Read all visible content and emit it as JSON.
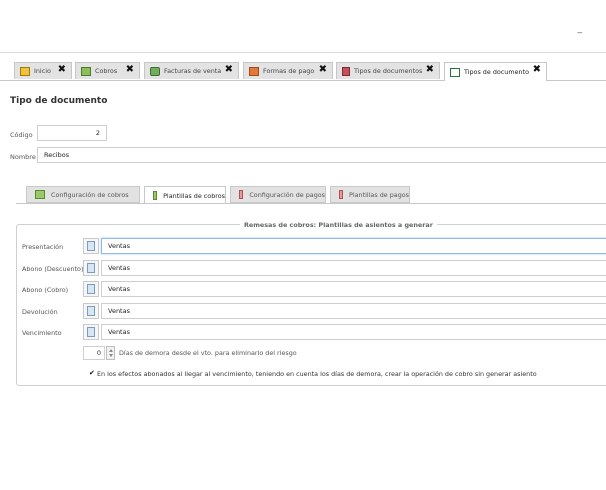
{
  "window": {
    "minimize_glyph": "_"
  },
  "tabs": [
    {
      "label": "Inicio",
      "icon": "home-icon",
      "close": "✖"
    },
    {
      "label": "Cobros",
      "icon": "cobros-icon",
      "close": "✖"
    },
    {
      "label": "Facturas de venta",
      "icon": "facturas-icon",
      "close": "✖"
    },
    {
      "label": "Formas de pago",
      "icon": "formas-pago-icon",
      "close": "✖"
    },
    {
      "label": "Tipos de documentos",
      "icon": "tipos-documentos-icon",
      "close": "✖"
    },
    {
      "label": "Tipos de documento",
      "icon": "window-icon",
      "close": "✖"
    }
  ],
  "form": {
    "title": "Tipo de documento",
    "codigo_label": "Código",
    "codigo_value": "2",
    "nombre_label": "Nombre",
    "nombre_value": "Recibos"
  },
  "subtabs": [
    {
      "label": "Configuración de cobros"
    },
    {
      "label": "Plantillas de cobros"
    },
    {
      "label": "Configuración de pagos"
    },
    {
      "label": "Plantillas de pagos"
    }
  ],
  "section": {
    "legend": "Remesas de cobros: Plantillas de asientos a generar",
    "rows": [
      {
        "label": "Presentación",
        "value": "Ventas"
      },
      {
        "label": "Abono (Descuento)",
        "value": "Ventas"
      },
      {
        "label": "Abono (Cobro)",
        "value": "Ventas"
      },
      {
        "label": "Devolución",
        "value": "Ventas"
      },
      {
        "label": "Vencimiento",
        "value": "Ventas"
      }
    ],
    "dias_value": "0",
    "dias_label": "Días de demora desde el vto. para eliminarlo del riesgo",
    "check_mark": "✔",
    "check_label": "En los efectos abonados al llegar al vencimiento, teniendo en cuenta los días de demora, crear la operación de cobro sin generar asiento"
  }
}
